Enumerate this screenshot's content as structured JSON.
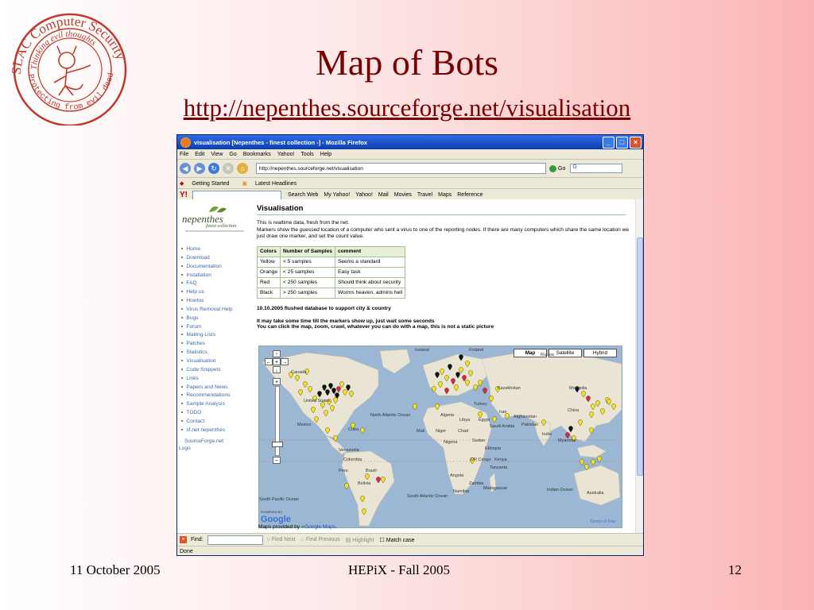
{
  "slide": {
    "title": "Map of Bots",
    "link": "http://nepenthes.sourceforge.net/visualisation",
    "footer_date": "11 October 2005",
    "footer_event": "HEPiX - Fall 2005",
    "page_number": "12"
  },
  "logo": {
    "text_top": "SLAC Computer Security",
    "text_inner": "Thinking evil thoughts",
    "text_bottom": "Protecting from evil deeds"
  },
  "browser": {
    "window_title": "visualisation [Nepenthes - finest collection -] - Mozilla Firefox",
    "menu": [
      "File",
      "Edit",
      "View",
      "Go",
      "Bookmarks",
      "Yahoo!",
      "Tools",
      "Help"
    ],
    "url": "http://nepenthes.sourceforge.net/visualisation",
    "go_label": "Go",
    "bookmarks": [
      "Getting Started",
      "Latest Headlines"
    ],
    "yahoo_toolbar": [
      "Search Web",
      "My Yahoo!",
      "Yahoo!",
      "Mail",
      "Movies",
      "Travel",
      "Maps",
      "Reference"
    ],
    "find_label": "Find:",
    "find_next": "Find Next",
    "find_previous": "Find Previous",
    "highlight": "Highlight",
    "match_case": "Match case",
    "status": "Done"
  },
  "site": {
    "logo_title": "nepenthes",
    "logo_sub": "finest collection",
    "nav": [
      "Home",
      "Download",
      "Documentation",
      "Installation",
      "FAQ",
      "Help us",
      "Howtos",
      "Virus Removal Help",
      "Bugs",
      "Forum",
      "Mailing-Lists",
      "Patches",
      "Statistics",
      "Visualisation",
      "Code Snippets",
      "Links",
      "Papers and News",
      "Recommendations",
      "Sample Analysis",
      "TODO",
      "Contact",
      "sf.net nepenthes"
    ],
    "sf_logo_line1": "SourceForge.net",
    "sf_logo_line2": "Logo"
  },
  "page": {
    "heading": "Visualisation",
    "intro1": "This is realtime data, fresh from the net.",
    "intro2_pre": "Markers show the ",
    "intro2_em": "guessed",
    "intro2_post": " location of a computer who sent a virus to one of the reporting nodes. If there are many computers which share the same location we just draw one marker, and set the count value.",
    "table_headers": [
      "Colors",
      "Number of Samples",
      "comment"
    ],
    "table_rows": [
      [
        "Yellow",
        "< 5 samples",
        "Seems a standard"
      ],
      [
        "Orange",
        "< 25 samples",
        "Easy task"
      ],
      [
        "Red",
        "< 250 samples",
        "Should think about security"
      ],
      [
        "Black",
        "> 250 samples",
        "Worms heaven, admins hell"
      ]
    ],
    "note1": "10.10.2005 flushed database to support city & country",
    "note2": "It may take some time till the markers show up, just wait some seconds",
    "note3": "You can click the map, zoom, crawl, whatever you can do with a map, this is not a static picture",
    "map_buttons": [
      "Map",
      "Satellite",
      "Hybrid"
    ],
    "maps_by_pre": "Maps provided by ",
    "maps_by_link": "Google Maps",
    "maps_by_post": ".",
    "map_labels": [
      "Iceland",
      "Finland",
      "Russia",
      "Canada",
      "Kazakhstan",
      "Mongolia",
      "United States",
      "North Atlantic Ocean",
      "China",
      "Turkey",
      "Iran",
      "Afghanistan",
      "Pakistan",
      "Mexico",
      "Cuba",
      "Algeria",
      "Libya",
      "Egypt",
      "Saudi Arabia",
      "India",
      "Mali",
      "Niger",
      "Chad",
      "Sudan",
      "Myanmar",
      "Nigeria",
      "Ethiopia",
      "Venezuela",
      "Colombia",
      "DR Congo",
      "Kenya",
      "Tanzania",
      "Brazil",
      "Peru",
      "Bolivia",
      "Angola",
      "Zambia",
      "Namibia",
      "Madagascar",
      "Indian Ocean",
      "South Pacific Ocean",
      "South Atlantic Ocean",
      "Australia",
      "Terms of Use"
    ],
    "powered_by": "POWERED BY",
    "google": "Google"
  }
}
